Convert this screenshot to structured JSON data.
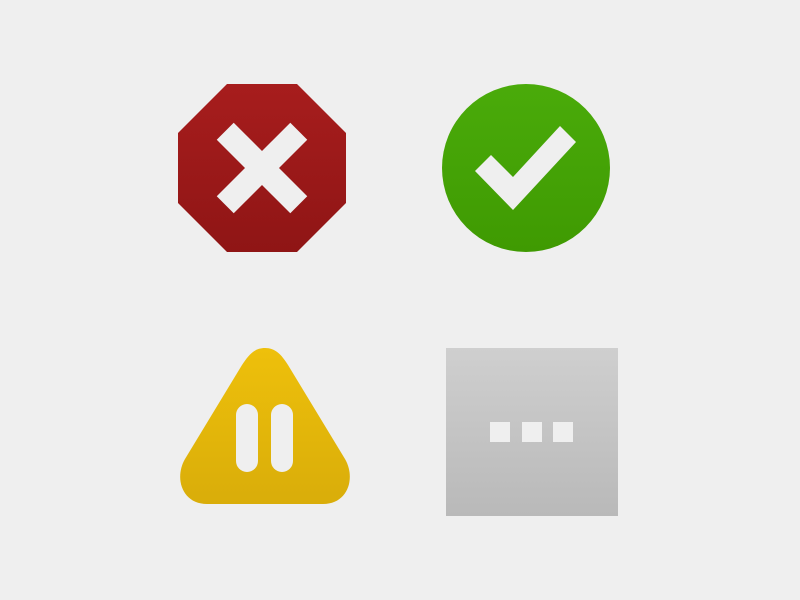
{
  "icons": [
    {
      "id": "error",
      "icon": "error-stop-icon",
      "symbol": "x-mark",
      "colors": {
        "top": "#a71d1d",
        "bottom": "#8f1515",
        "glyph": "#efefef"
      }
    },
    {
      "id": "success",
      "icon": "success-check-icon",
      "symbol": "check-mark",
      "colors": {
        "top": "#4aab0a",
        "bottom": "#3f9a02",
        "glyph": "#efefef"
      }
    },
    {
      "id": "paused",
      "icon": "paused-warning-icon",
      "symbol": "pause-bars",
      "colors": {
        "top": "#eec00b",
        "bottom": "#d9ad0a",
        "glyph": "#efefef"
      }
    },
    {
      "id": "pending",
      "icon": "pending-ellipsis-icon",
      "symbol": "three-dots",
      "colors": {
        "top": "#cfcfcf",
        "bottom": "#b9b9b9",
        "glyph": "#efefef"
      }
    }
  ],
  "background": "#efefef"
}
